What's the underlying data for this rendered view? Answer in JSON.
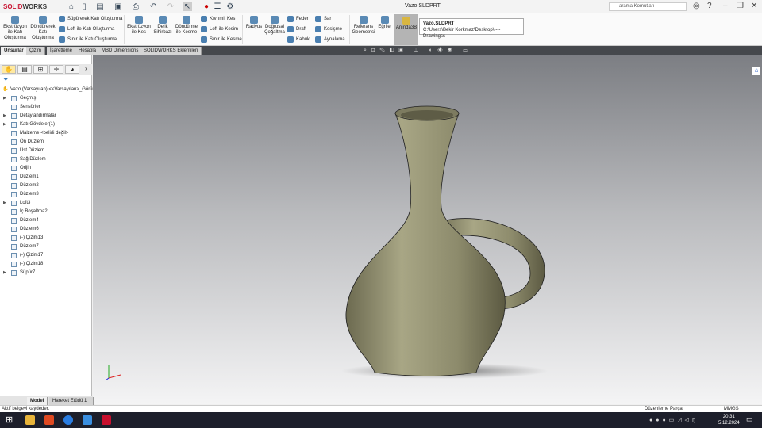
{
  "app": {
    "logo_a": "SOLID",
    "logo_b": "WORKS",
    "document_title": "Vazo.SLDPRT",
    "search_placeholder": "arama Komutları"
  },
  "ribbon": {
    "big": [
      "Ekstrüzyon ile Katı Oluşturma",
      "Döndürerek Katı Oluşturma",
      "Ekstrüzyon ile Kes",
      "Delik Sihirbazı",
      "Döndürme ile Kesme",
      "Radyus",
      "Doğrusal Çoğaltma",
      "Referans Geometrisi",
      "Eğriler",
      "Anında3B"
    ],
    "small": [
      "Süpürerek Katı Oluşturma",
      "Loft ile Katı Oluşturma",
      "Sınır ile Katı Oluşturma",
      "Kıvrımlı Kes",
      "Loft ile Kesim",
      "Sınır ile Kesme",
      "Feder",
      "Draft",
      "Kabuk",
      "Sar",
      "Kesişme",
      "Aynalama"
    ]
  },
  "tooltip": {
    "title": "Vazo.SLDPRT",
    "path": "C:\\Users\\Bekir Korkmaz\\Desktop\\----Drawingss"
  },
  "tabs": [
    "Unsurlar",
    "Çizim",
    "İşaretleme",
    "Hesapla",
    "MBD Dimensions",
    "SOLIDWORKS Eklentileri"
  ],
  "tree": {
    "root": "Vazo (Varsayılan) <<Varsayılan>_Görün",
    "items": [
      {
        "label": "Geçmiş",
        "exp": true
      },
      {
        "label": "Sensörler",
        "exp": false
      },
      {
        "label": "Detaylandırmalar",
        "exp": true
      },
      {
        "label": "Katı Gövdeler(1)",
        "exp": true
      },
      {
        "label": "Malzeme <belirli değil>",
        "exp": false
      },
      {
        "label": "Ön Düzlem",
        "exp": false
      },
      {
        "label": "Üst Düzlem",
        "exp": false
      },
      {
        "label": "Sağ Düzlem",
        "exp": false
      },
      {
        "label": "Orijin",
        "exp": false
      },
      {
        "label": "Düzlem1",
        "exp": false
      },
      {
        "label": "Düzlem2",
        "exp": false
      },
      {
        "label": "Düzlem3",
        "exp": false
      },
      {
        "label": "Loft3",
        "exp": true
      },
      {
        "label": "İç Boşaltma2",
        "exp": false
      },
      {
        "label": "Düzlem4",
        "exp": false
      },
      {
        "label": "Düzlem6",
        "exp": false
      },
      {
        "label": "(-) Çizim13",
        "exp": false
      },
      {
        "label": "Düzlem7",
        "exp": false
      },
      {
        "label": "(-) Çizim17",
        "exp": false
      },
      {
        "label": "(-) Çizim18",
        "exp": false
      },
      {
        "label": "Süpür7",
        "exp": true
      }
    ]
  },
  "bottom_tabs": [
    "Model",
    "Hareket Etüdü 1"
  ],
  "status": {
    "message": "Aktif belgeyi kaydeder.",
    "mode": "Düzenleme Parça",
    "units": "MMGS"
  },
  "taskbar": {
    "time": "20:31",
    "date": "5.12.2024"
  },
  "colors": {
    "part": "#8c8a6a",
    "brand": "#c8102e",
    "selection": "#0078d7"
  }
}
